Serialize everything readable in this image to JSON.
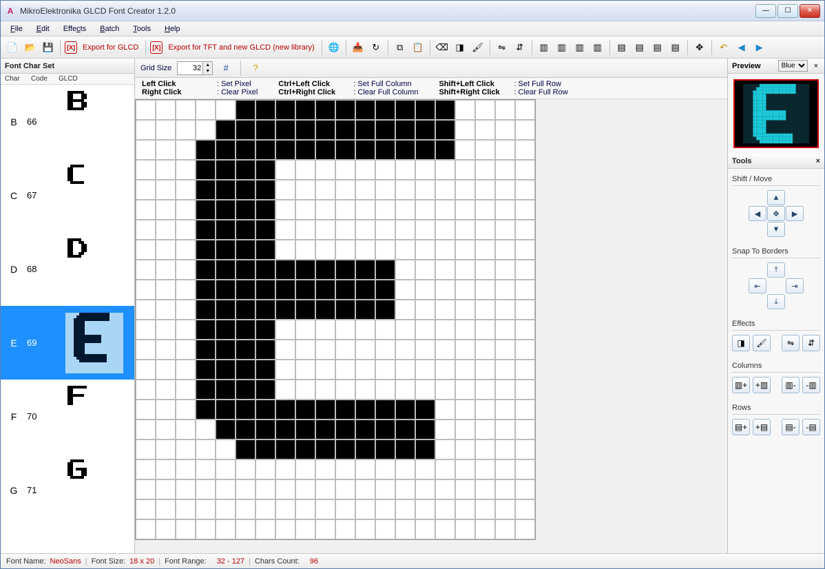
{
  "window": {
    "title": "MikroElektronika GLCD Font Creator 1.2.0"
  },
  "menu": [
    "File",
    "Edit",
    "Effects",
    "Batch",
    "Tools",
    "Help"
  ],
  "export_glcd_label": "Export for GLCD",
  "export_tft_label": "Export for TFT and new GLCD (new library)",
  "left": {
    "title": "Font Char Set",
    "cols": [
      "Char",
      "Code",
      "GLCD"
    ],
    "chars": [
      {
        "ch": "B",
        "code": "66"
      },
      {
        "ch": "C",
        "code": "67"
      },
      {
        "ch": "D",
        "code": "68"
      },
      {
        "ch": "E",
        "code": "69",
        "selected": true
      },
      {
        "ch": "F",
        "code": "70"
      },
      {
        "ch": "G",
        "code": "71"
      }
    ]
  },
  "grid": {
    "size_label": "Grid Size",
    "size_value": "32",
    "hints": [
      {
        "k": "Left Click",
        "v": ": Set Pixel"
      },
      {
        "k": "Right Click",
        "v": ": Clear Pixel"
      },
      {
        "k": "Ctrl+Left Click",
        "v": ": Set Full Column"
      },
      {
        "k": "Ctrl+Right Click",
        "v": ": Clear Full Column"
      },
      {
        "k": "Shift+Left Click",
        "v": ": Set Full Row"
      },
      {
        "k": "Shift+Right Click",
        "v": ": Clear Full Row"
      }
    ]
  },
  "preview": {
    "title": "Preview",
    "scheme": "Blue"
  },
  "tools": {
    "title": "Tools",
    "shift_label": "Shift / Move",
    "snap_label": "Snap To Borders",
    "effects_label": "Effects",
    "columns_label": "Columns",
    "rows_label": "Rows"
  },
  "status": {
    "font_name_label": "Font Name:",
    "font_name": "NeoSans",
    "font_size_label": "Font Size:",
    "font_size": "18 x 20",
    "font_range_label": "Font Range:",
    "font_range": "32 - 127",
    "chars_count_label": "Chars Count:",
    "chars_count": "96"
  },
  "chart_data": {
    "type": "table",
    "note": "Pixel bitmap for selected glyph 'E' on a 20x22 grid; 1=filled(black), 0=empty",
    "cols": 20,
    "rows": 22,
    "pixels": [
      "00000111111111110000",
      "00001111111111110000",
      "00011111111111110000",
      "00011110000000000000",
      "00011110000000000000",
      "00011110000000000000",
      "00011110000000000000",
      "00011110000000000000",
      "00011111111110000000",
      "00011111111110000000",
      "00011111111110000000",
      "00011110000000000000",
      "00011110000000000000",
      "00011110000000000000",
      "00011110000000000000",
      "00011111111111100000",
      "00001111111111100000",
      "00000111111111100000",
      "00000000000000000000",
      "00000000000000000000",
      "00000000000000000000",
      "00000000000000000000"
    ]
  }
}
